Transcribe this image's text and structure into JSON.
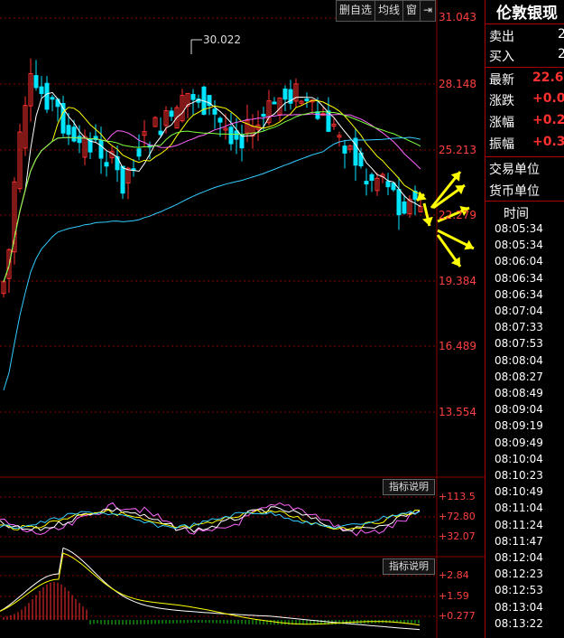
{
  "toolbar": {
    "delete_select": "删自选",
    "ma_line": "均线",
    "window": "窗",
    "window_icon": "⇥"
  },
  "price_axis": [
    "31.043",
    "28.148",
    "25.213",
    "22.279",
    "19.384",
    "16.489",
    "13.554"
  ],
  "high_marker": "30.022",
  "indicator1": {
    "button": "指标说明",
    "labels": [
      "+113.5",
      "+72.80",
      "+32.07"
    ]
  },
  "indicator2": {
    "button": "指标说明",
    "labels": [
      "+2.84",
      "+1.59",
      "+0.277"
    ]
  },
  "panel": {
    "title": "伦敦银现",
    "sell_label": "卖出",
    "sell_value": "2",
    "buy_label": "买入",
    "buy_value": "2",
    "latest_label": "最新",
    "latest_value": "22.6",
    "change_label": "涨跌",
    "change_value": "+0.0",
    "change_pct_label": "涨幅",
    "change_pct_value": "+0.2",
    "amplitude_label": "振幅",
    "amplitude_value": "+0.3",
    "trade_unit_label": "交易单位",
    "currency_unit_label": "货币单位",
    "time_header": "时间",
    "times": [
      "08:05:34",
      "08:05:34",
      "08:06:04",
      "08:06:34",
      "08:06:34",
      "08:07:04",
      "08:07:33",
      "08:07:53",
      "08:08:04",
      "08:08:27",
      "08:08:49",
      "08:09:04",
      "08:09:19",
      "08:09:49",
      "08:10:04",
      "08:10:23",
      "08:10:49",
      "08:11:04",
      "08:11:24",
      "08:11:47",
      "08:12:04",
      "08:12:23",
      "08:12:53",
      "08:13:04",
      "08:13:22"
    ]
  },
  "colors": {
    "up": "#ff3030",
    "down": "#00e5ff",
    "grid": "#8b0000",
    "ma5": "#ffffff",
    "ma10": "#ffff00",
    "ma20": "#ff66ff",
    "ma30": "#7fff3f",
    "ma60": "#33ccff",
    "arrow": "#ffff00"
  }
}
